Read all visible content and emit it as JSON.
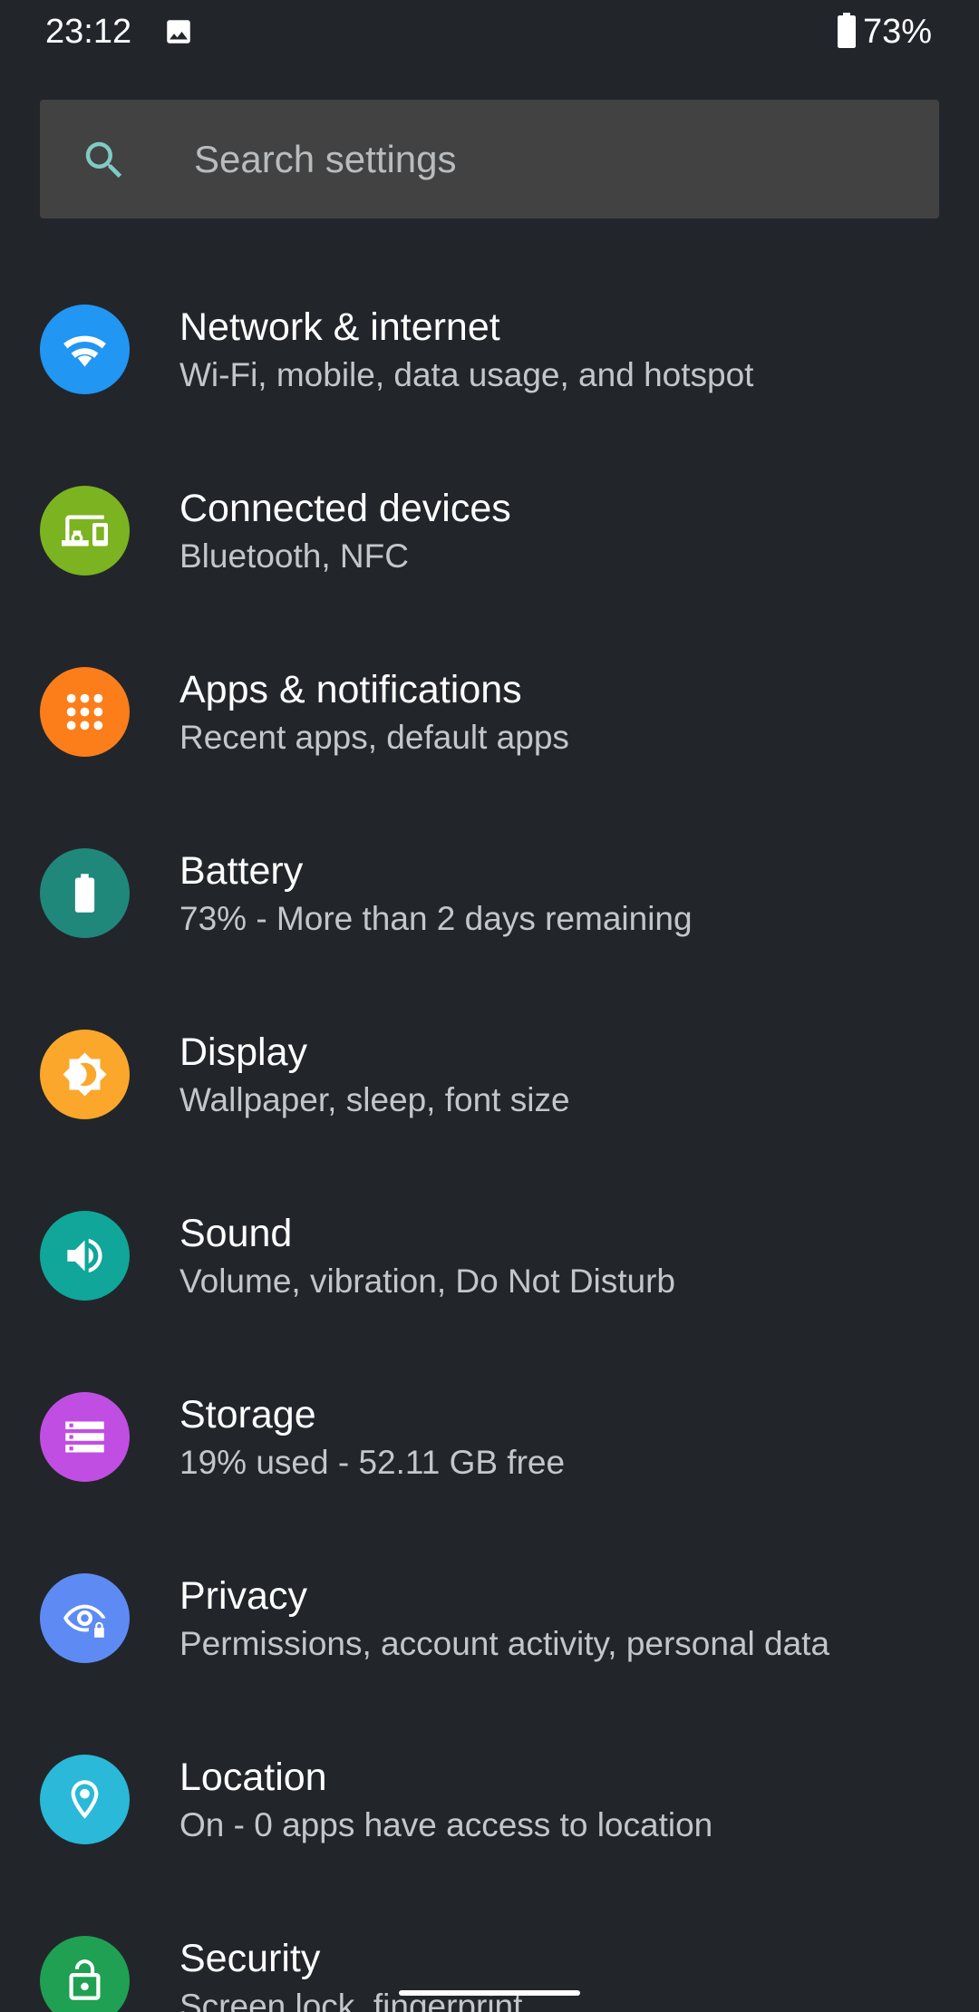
{
  "status_bar": {
    "time": "23:12",
    "battery_percent": "73%",
    "notification_icon": "image-icon",
    "battery_icon": "battery-icon"
  },
  "search": {
    "placeholder": "Search settings",
    "icon": "search-icon",
    "icon_color": "#80cbc4"
  },
  "settings": [
    {
      "title": "Network & internet",
      "subtitle": "Wi-Fi, mobile, data usage, and hotspot",
      "icon": "wifi-icon",
      "color": "#2196f3"
    },
    {
      "title": "Connected devices",
      "subtitle": "Bluetooth, NFC",
      "icon": "devices-icon",
      "color": "#7cb321"
    },
    {
      "title": "Apps & notifications",
      "subtitle": "Recent apps, default apps",
      "icon": "apps-icon",
      "color": "#fb7e1b"
    },
    {
      "title": "Battery",
      "subtitle": "73% - More than 2 days remaining",
      "icon": "battery-icon",
      "color": "#20877b"
    },
    {
      "title": "Display",
      "subtitle": "Wallpaper, sleep, font size",
      "icon": "brightness-icon",
      "color": "#fba72b"
    },
    {
      "title": "Sound",
      "subtitle": "Volume, vibration, Do Not Disturb",
      "icon": "volume-icon",
      "color": "#10a69a"
    },
    {
      "title": "Storage",
      "subtitle": "19% used - 52.11 GB free",
      "icon": "storage-icon",
      "color": "#c14ee3"
    },
    {
      "title": "Privacy",
      "subtitle": "Permissions, account activity, personal data",
      "icon": "privacy-icon",
      "color": "#5e8bf3"
    },
    {
      "title": "Location",
      "subtitle": "On - 0 apps have access to location",
      "icon": "location-pin-icon",
      "color": "#2ab9d8"
    },
    {
      "title": "Security",
      "subtitle": "Screen lock, fingerprint",
      "icon": "lock-open-icon",
      "color": "#1fa053"
    }
  ],
  "colors": {
    "background": "#22262b",
    "search_background": "#424242",
    "title_text": "#ffffff",
    "subtitle_text": "#c4c7ca"
  }
}
